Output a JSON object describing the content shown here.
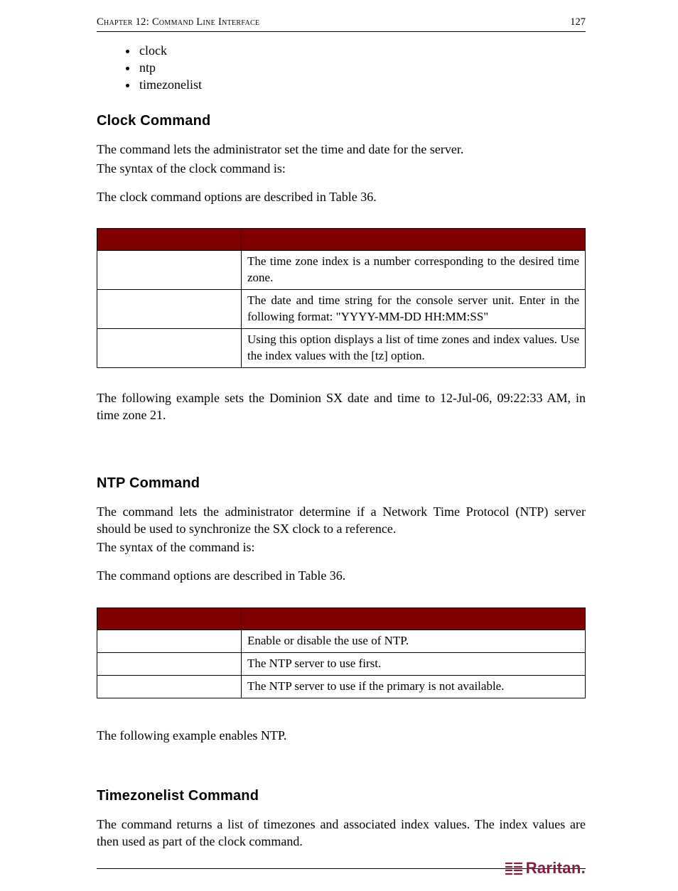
{
  "header": {
    "chapter": "Chapter 12: Command Line Interface",
    "page": "127"
  },
  "bullets": [
    "clock",
    "ntp",
    "timezonelist"
  ],
  "clock": {
    "title": "Clock Command",
    "p1a": "The ",
    "p1b": " command lets the administrator set the time and date for the server.",
    "p2": "The syntax of the clock command is:",
    "p3": "The clock command options are described in Table 36.",
    "th1": " ",
    "th2": " ",
    "rows": [
      {
        "d": "The time zone index is a number corresponding to the desired time zone."
      },
      {
        "d": "The date and time string for the console server unit. Enter in the following format: \"YYYY-MM-DD HH:MM:SS\""
      },
      {
        "d": "Using this option displays a list of time zones and index values. Use the index values with the [tz] option."
      }
    ],
    "ex": "The following example sets the Dominion SX date and time to 12-Jul-06, 09:22:33 AM, in time zone 21."
  },
  "ntp": {
    "title": "NTP Command",
    "p1a": "The ",
    "p1b": " command lets the administrator determine if a Network Time Protocol (NTP) server should be used to synchronize the SX clock to a reference.",
    "p2": "The syntax of the command is:",
    "p3": "The command options are described in Table 36.",
    "th1": " ",
    "th2": " ",
    "rows": [
      {
        "d": "Enable or disable the use of NTP."
      },
      {
        "d": "The NTP server to use first."
      },
      {
        "d": "The NTP server to use if the primary is not available."
      }
    ],
    "ex": "The following example enables NTP."
  },
  "tz": {
    "title": "Timezonelist Command",
    "p1a": "The ",
    "p1b": " command returns a list of timezones and associated index values. The index values are then used as part of the clock command."
  },
  "logo": "Raritan."
}
